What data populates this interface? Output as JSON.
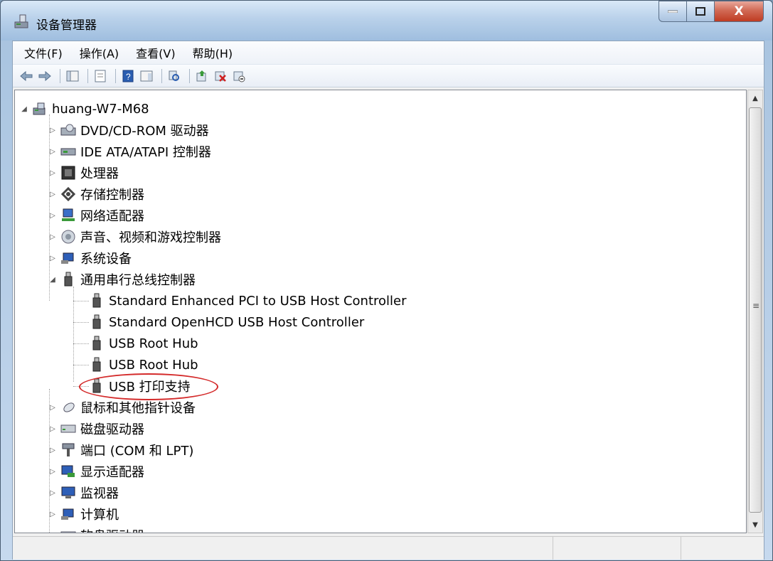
{
  "window": {
    "title": "设备管理器",
    "close_label": "X"
  },
  "menubar": {
    "items": [
      "文件(F)",
      "操作(A)",
      "查看(V)",
      "帮助(H)"
    ]
  },
  "toolbar": {
    "buttons": [
      "back-icon",
      "forward-icon",
      "show-hide-console-tree-icon",
      "properties-icon",
      "help-icon",
      "view-icon",
      "scan-hardware-icon",
      "update-driver-icon",
      "uninstall-icon",
      "disable-icon"
    ]
  },
  "tree": {
    "root": "huang-W7-M68",
    "categories": [
      {
        "label": "DVD/CD-ROM 驱动器",
        "icon": "dvd-drive-icon"
      },
      {
        "label": "IDE ATA/ATAPI 控制器",
        "icon": "ide-controller-icon"
      },
      {
        "label": "处理器",
        "icon": "processor-icon"
      },
      {
        "label": "存储控制器",
        "icon": "storage-controller-icon"
      },
      {
        "label": "网络适配器",
        "icon": "network-adapter-icon"
      },
      {
        "label": "声音、视频和游戏控制器",
        "icon": "sound-icon"
      },
      {
        "label": "系统设备",
        "icon": "system-device-icon"
      },
      {
        "label": "通用串行总线控制器",
        "icon": "usb-icon",
        "expanded": true
      }
    ],
    "usb_children": [
      "Standard Enhanced PCI to USB Host Controller",
      "Standard OpenHCD USB Host Controller",
      "USB Root Hub",
      "USB Root Hub",
      "USB 打印支持"
    ],
    "after_categories": [
      {
        "label": "鼠标和其他指针设备",
        "icon": "mouse-icon"
      },
      {
        "label": "磁盘驱动器",
        "icon": "disk-drive-icon"
      },
      {
        "label": "端口 (COM 和 LPT)",
        "icon": "port-icon"
      },
      {
        "label": "显示适配器",
        "icon": "display-adapter-icon"
      },
      {
        "label": "监视器",
        "icon": "monitor-icon"
      },
      {
        "label": "计算机",
        "icon": "computer-icon"
      },
      {
        "label": "软盘驱动器",
        "icon": "floppy-icon"
      }
    ]
  },
  "colors": {
    "highlight_ring": "#d42a2a",
    "titlebar": "#b9d1ea"
  }
}
